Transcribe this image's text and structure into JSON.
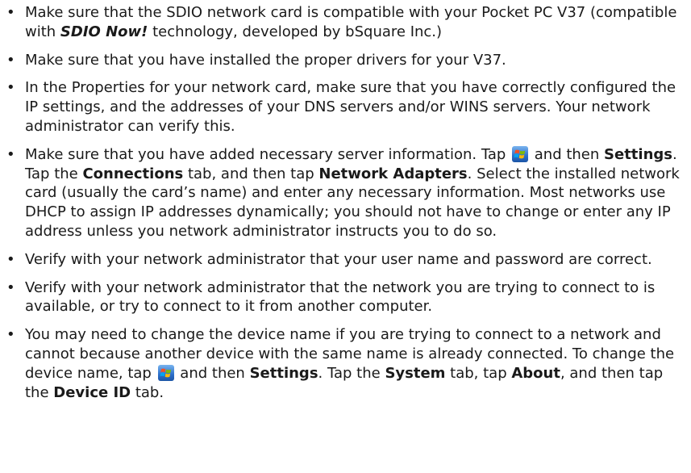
{
  "bullets": [
    {
      "parts": [
        "Make sure that the SDIO network card is compatible with your Pocket PC V37 (compatible with ",
        "SDIO Now!",
        " technology, developed by bSquare Inc.)"
      ]
    },
    {
      "parts": [
        "Make sure that you have installed the proper drivers for your V37."
      ]
    },
    {
      "parts": [
        "In the Properties for your network card, make sure that you have correctly configured the IP settings, and the addresses of your DNS servers and/or WINS servers. Your network administrator can verify this."
      ]
    },
    {
      "parts": [
        "Make sure that you have added necessary server information. Tap ",
        " and then ",
        "Settings",
        ". Tap the ",
        "Connections",
        " tab, and then tap ",
        "Network Adapters",
        ". Select the installed network card (usually the card’s name) and enter any necessary information. Most networks use DHCP to assign IP addresses dynamically; you should not have to change or enter any IP address unless you network administrator instructs you to do so."
      ]
    },
    {
      "parts": [
        "Verify with your network administrator that your user name and password are correct."
      ]
    },
    {
      "parts": [
        "Verify with your network administrator that the network you are trying to connect to is available, or try to connect to it from another computer."
      ]
    },
    {
      "parts": [
        "You may need to change the device name if you are trying to connect to a network and cannot because another device with the same name is already connected. To change the device name, tap ",
        " and then ",
        "Settings",
        ". Tap the ",
        "System",
        " tab, tap ",
        "About",
        ", and then tap the ",
        "Device ID",
        " tab."
      ]
    }
  ],
  "bullet_glyph": "•",
  "icons": {
    "start": "windows-start-icon"
  }
}
